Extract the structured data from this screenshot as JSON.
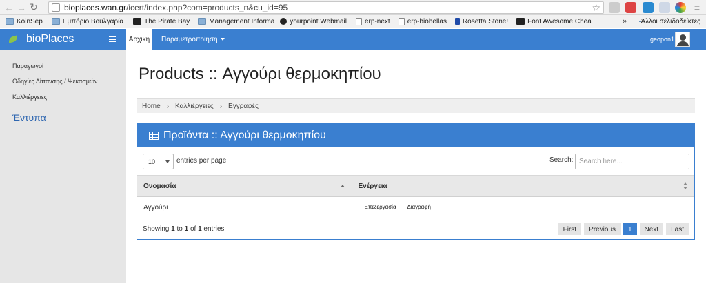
{
  "browser": {
    "url_host": "bioplaces.wan.gr",
    "url_path": "/icert/index.php?com=products_n&cu_id=95",
    "bookmarks": [
      {
        "label": "KoinSep",
        "icon": "folder-icon"
      },
      {
        "label": "Εμπόριο Βουλγαρία",
        "icon": "folder-icon"
      },
      {
        "label": "The Pirate Bay",
        "icon": "ship-icon"
      },
      {
        "label": "Management Informa",
        "icon": "folder-icon"
      },
      {
        "label": "yourpoint.Webmail",
        "icon": "gear-icon"
      },
      {
        "label": "erp-next",
        "icon": "page-icon"
      },
      {
        "label": "erp-biohellas",
        "icon": "page-icon"
      },
      {
        "label": "Rosetta Stone!",
        "icon": "rosetta-icon"
      },
      {
        "label": "Font Awesome Chea",
        "icon": "font-awesome-icon"
      }
    ],
    "bookmarks_more": "»",
    "other_bookmarks": "Άλλοι σελιδοδείκτες"
  },
  "appbar": {
    "brand": "bioPlaces",
    "home_tab": "Αρχική",
    "params_menu": "Παραμετροποίηση",
    "username": "geopon1"
  },
  "sidebar": {
    "items": [
      "Παραγωγοί",
      "Οδηγίες Λίπανσης / Ψεκασμών",
      "Καλλιέργειες"
    ],
    "section_title": "Έντυπα"
  },
  "main": {
    "title": "Products :: Αγγούρι θερμοκηπίου",
    "breadcrumb": [
      "Home",
      "Καλλιέργειες",
      "Εγγραφές"
    ],
    "panel_title": "Προϊόντα :: Αγγούρι θερμοκηπίου",
    "page_size": "10",
    "entries_per_page": "entries per page",
    "search_label": "Search:",
    "search_placeholder": "Search here...",
    "columns": [
      "Ονομασία",
      "Ενέργεια"
    ],
    "rows": [
      {
        "name": "Αγγούρι",
        "edit": "Επεξεργασία",
        "delete": "Διαγραφή"
      }
    ],
    "info": {
      "prefix": "Showing",
      "from": "1",
      "to_word": "to",
      "to": "1",
      "of_word": "of",
      "total": "1",
      "suffix": "entries"
    },
    "pager": {
      "first": "First",
      "previous": "Previous",
      "current": "1",
      "next": "Next",
      "last": "Last"
    }
  },
  "colors": {
    "primary": "#3a7fd0",
    "sidebar": "#e6e6e6",
    "accent_text": "#2e66b0"
  }
}
